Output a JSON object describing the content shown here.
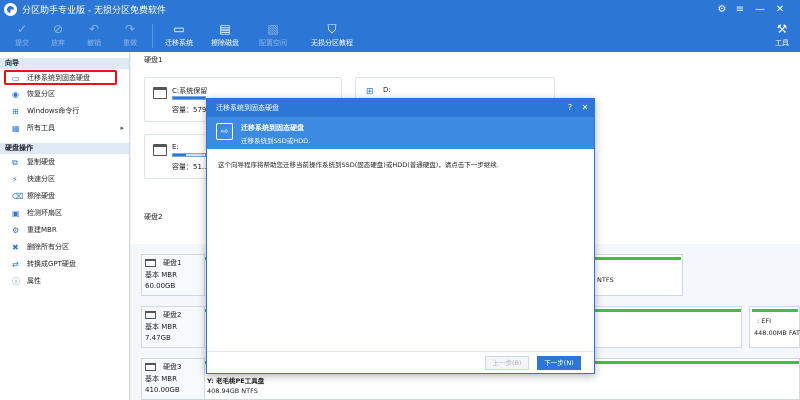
{
  "window": {
    "title": "分区助手专业版 - 无损分区免费软件"
  },
  "toolbar": {
    "commit": "提交",
    "discard": "放弃",
    "undo": "撤销",
    "redo": "重做",
    "migrate": "迁移系统",
    "wipe": "擦除磁盘",
    "allocate": "配置空间",
    "tutorial": "无损分区教程",
    "tools": "工具"
  },
  "sidebar": {
    "wizard_title": "向导",
    "wizard_items": [
      {
        "label": "迁移系统到固态硬盘",
        "icon": "migrate-icon"
      },
      {
        "label": "恢复分区",
        "icon": "restore-icon"
      },
      {
        "label": "Windows命令行",
        "icon": "windows-icon"
      },
      {
        "label": "所有工具",
        "icon": "tools-icon"
      }
    ],
    "disk_ops_title": "硬盘操作",
    "disk_items": [
      {
        "label": "复制硬盘",
        "icon": "copy-disk-icon"
      },
      {
        "label": "快速分区",
        "icon": "quick-partition-icon"
      },
      {
        "label": "擦除硬盘",
        "icon": "wipe-disk-icon"
      },
      {
        "label": "检测坏扇区",
        "icon": "bad-sector-icon"
      },
      {
        "label": "重建MBR",
        "icon": "rebuild-mbr-icon"
      },
      {
        "label": "删除所有分区",
        "icon": "delete-partitions-icon"
      },
      {
        "label": "转换成GPT硬盘",
        "icon": "convert-gpt-icon"
      },
      {
        "label": "属性",
        "icon": "properties-icon"
      }
    ]
  },
  "main": {
    "disk1_header": "硬盘1",
    "disk2_header": "硬盘2",
    "card_c": {
      "name": "C:系统保留",
      "capacity": "容量：579.0"
    },
    "card_d": {
      "name": "D:"
    },
    "card_e": {
      "name": "E:",
      "capacity": "容量：51..."
    },
    "disks": [
      {
        "name": "硬盘1",
        "type": "基本 MBR",
        "size": "60.00GB"
      },
      {
        "name": "硬盘2",
        "type": "基本 MBR",
        "size": "7.47GB"
      },
      {
        "name": "硬盘3",
        "type": "基本 MBR",
        "size": "410.00GB"
      }
    ],
    "ntfs_label": "NTFS",
    "efi_name": ": EFI",
    "efi_size": "448.00MB FAT",
    "disk3_part_name": "Y: 老毛桃PE工具盘",
    "disk3_part_size": "408.94GB NTFS"
  },
  "dialog": {
    "title": "迁移系统到固态硬盘",
    "head_title": "迁移系统到固态硬盘",
    "head_subtitle": "迁移系统到SSD或HDD.",
    "description": "这个向导程序将帮助您迁移当前操作系统到SSD(固态硬盘)或HDD(普通硬盘)，请点击下一步继续.",
    "prev": "上一步(B)",
    "next": "下一步(N)",
    "help": "?",
    "close": "✕"
  },
  "colors": {
    "accent": "#2c77d6",
    "selection": "#e11111",
    "used": "#4cb84c"
  }
}
